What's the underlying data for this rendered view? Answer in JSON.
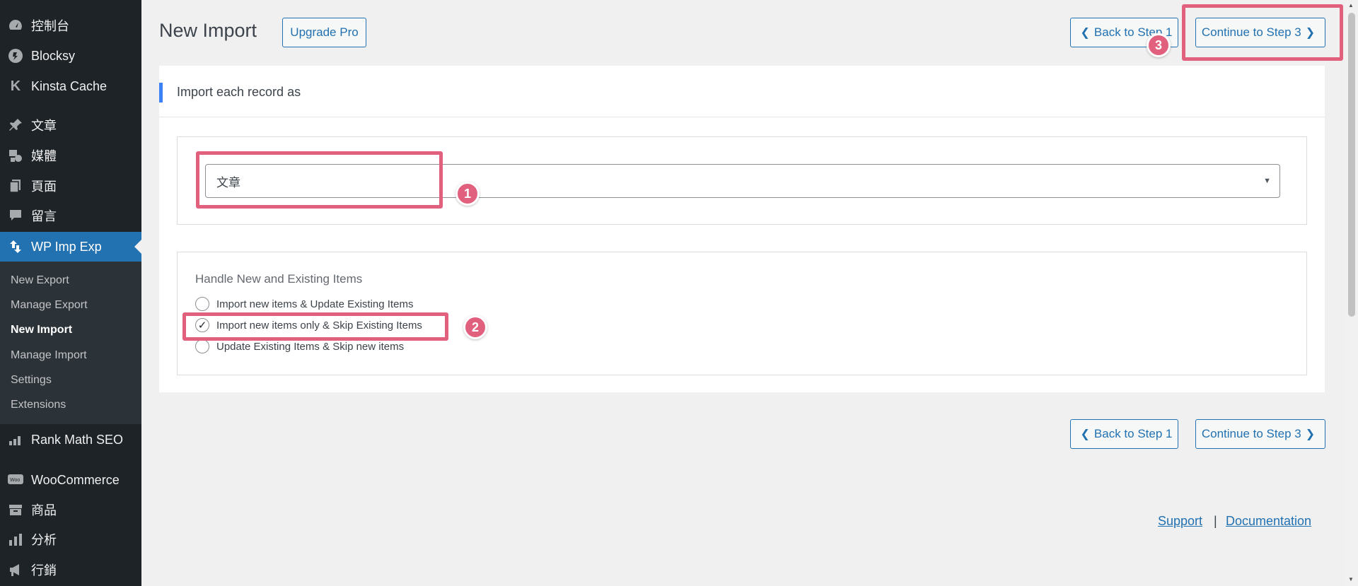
{
  "sidebar": {
    "items": [
      {
        "label": "控制台",
        "icon": "dashboard-icon"
      },
      {
        "label": "Blocksy",
        "icon": "blocksy-icon"
      },
      {
        "label": "Kinsta Cache",
        "icon": "kinsta-icon"
      },
      {
        "label": "文章",
        "icon": "pin-icon"
      },
      {
        "label": "媒體",
        "icon": "media-icon"
      },
      {
        "label": "頁面",
        "icon": "pages-icon"
      },
      {
        "label": "留言",
        "icon": "comments-icon"
      },
      {
        "label": "WP Imp Exp",
        "icon": "import-export-icon"
      },
      {
        "label": "Rank Math SEO",
        "icon": "rank-math-icon"
      },
      {
        "label": "WooCommerce",
        "icon": "woocommerce-icon"
      },
      {
        "label": "商品",
        "icon": "products-icon"
      },
      {
        "label": "分析",
        "icon": "analytics-icon"
      },
      {
        "label": "行銷",
        "icon": "marketing-icon"
      }
    ],
    "submenu": [
      "New Export",
      "Manage Export",
      "New Import",
      "Manage Import",
      "Settings",
      "Extensions"
    ]
  },
  "header": {
    "title": "New Import",
    "upgrade_label": "Upgrade Pro",
    "back_label": "Back to Step 1",
    "continue_label": "Continue to Step 3"
  },
  "main": {
    "section_title": "Import each record as",
    "record_type_value": "文章",
    "handle_heading": "Handle New and Existing Items",
    "options": [
      {
        "label": "Import new items & Update Existing Items",
        "checked": false
      },
      {
        "label": "Import new items only & Skip Existing Items",
        "checked": true
      },
      {
        "label": "Update Existing Items & Skip new items",
        "checked": false
      }
    ]
  },
  "footer": {
    "back_label": "Back to Step 1",
    "continue_label": "Continue to Step 3",
    "support": "Support",
    "separator": "|",
    "documentation": "Documentation"
  },
  "annotations": [
    "1",
    "2",
    "3"
  ],
  "colors": {
    "accent": "#2271b1",
    "highlight": "#e0607e",
    "sidebar": "#1d2327"
  }
}
